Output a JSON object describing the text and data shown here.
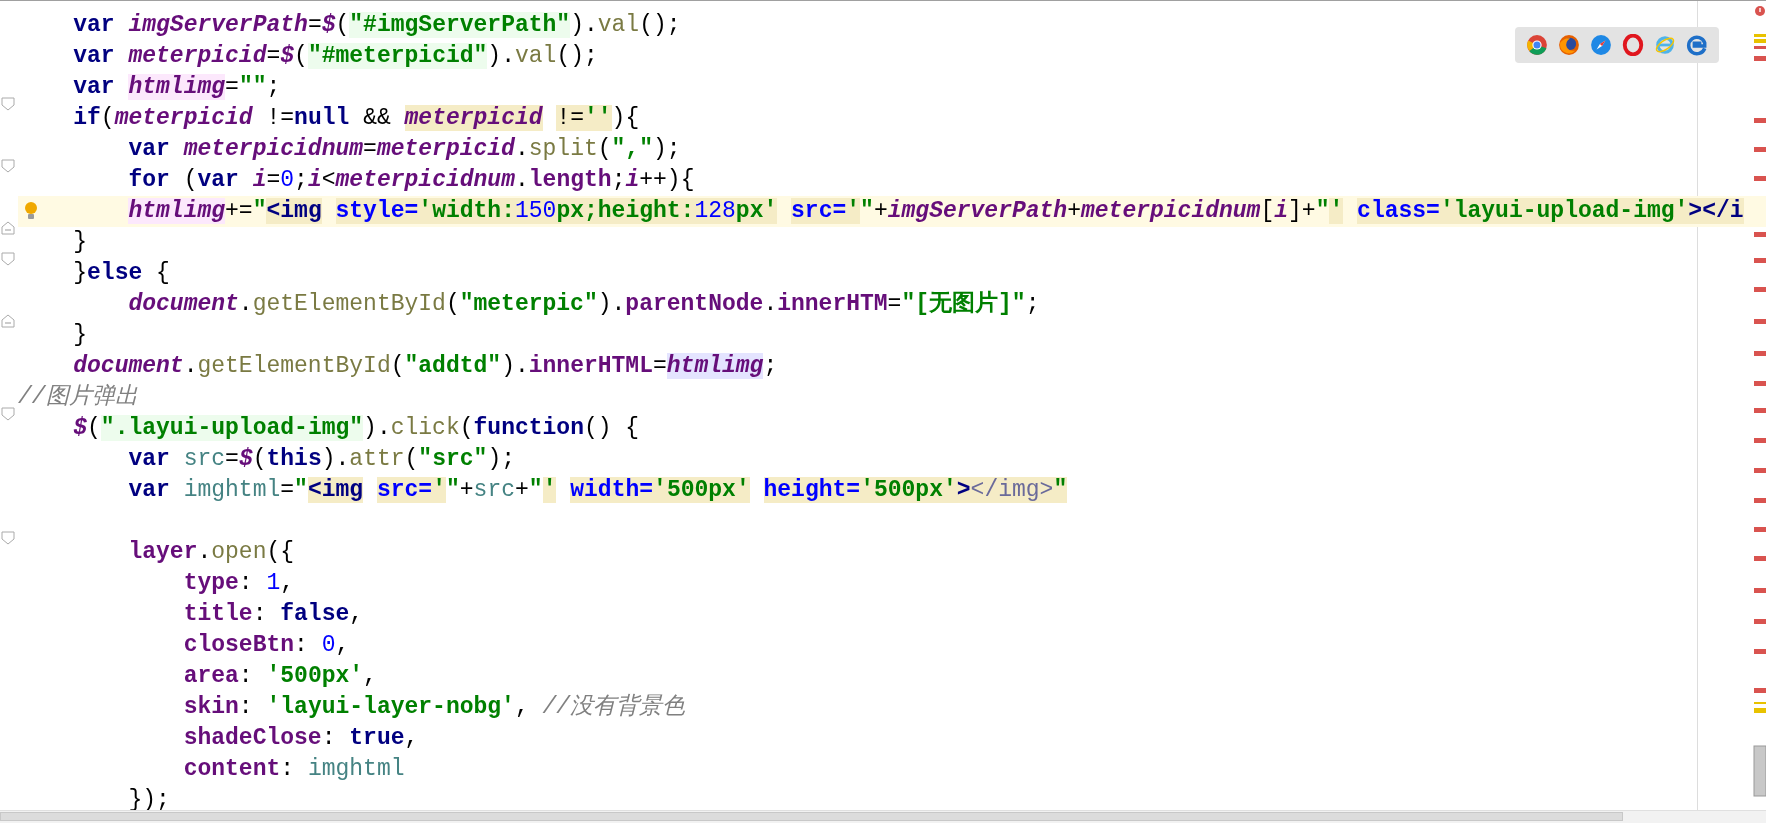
{
  "lines": [
    {
      "kind": "code",
      "current": false,
      "tokens": [
        {
          "text": "    var ",
          "kind": "kw"
        },
        {
          "text": "imgServerPath",
          "kind": "var"
        },
        {
          "text": "=",
          "kind": "plain"
        },
        {
          "text": "$",
          "kind": "glob"
        },
        {
          "text": "(",
          "kind": "plain"
        },
        {
          "text": "\"#imgServerPath\"",
          "kind": "str",
          "ref": true
        },
        {
          "text": ").",
          "kind": "plain"
        },
        {
          "text": "val",
          "kind": "fn"
        },
        {
          "text": "();",
          "kind": "plain"
        }
      ]
    },
    {
      "kind": "code",
      "current": false,
      "tokens": [
        {
          "text": "    var ",
          "kind": "kw"
        },
        {
          "text": "meterpicid",
          "kind": "var"
        },
        {
          "text": "=",
          "kind": "plain"
        },
        {
          "text": "$",
          "kind": "glob"
        },
        {
          "text": "(",
          "kind": "plain"
        },
        {
          "text": "\"#meterpicid\"",
          "kind": "str",
          "ref": true
        },
        {
          "text": ").",
          "kind": "plain"
        },
        {
          "text": "val",
          "kind": "fn"
        },
        {
          "text": "();",
          "kind": "plain"
        }
      ]
    },
    {
      "kind": "code",
      "current": false,
      "tokens": [
        {
          "text": "    var ",
          "kind": "kw"
        },
        {
          "text": "htmlimg",
          "kind": "var",
          "write": true
        },
        {
          "text": "=",
          "kind": "plain"
        },
        {
          "text": "\"\"",
          "kind": "str"
        },
        {
          "text": ";",
          "kind": "plain"
        }
      ]
    },
    {
      "kind": "code",
      "current": false,
      "fold_start": true,
      "tokens": [
        {
          "text": "    if",
          "kind": "kw"
        },
        {
          "text": "(",
          "kind": "plain"
        },
        {
          "text": "meterpicid",
          "kind": "var"
        },
        {
          "text": " !=",
          "kind": "plain"
        },
        {
          "text": "null",
          "kind": "kw"
        },
        {
          "text": " && ",
          "kind": "plain"
        },
        {
          "text": "meterpicid",
          "kind": "var",
          "injected": true
        },
        {
          "text": " !=",
          "kind": "plain",
          "injected": true
        },
        {
          "text": "''",
          "kind": "str",
          "injected": true
        },
        {
          "text": "){",
          "kind": "plain"
        }
      ]
    },
    {
      "kind": "code",
      "current": false,
      "tokens": [
        {
          "text": "        var ",
          "kind": "kw"
        },
        {
          "text": "meterpicidnum",
          "kind": "var"
        },
        {
          "text": "=",
          "kind": "plain"
        },
        {
          "text": "meterpicid",
          "kind": "var"
        },
        {
          "text": ".",
          "kind": "plain"
        },
        {
          "text": "split",
          "kind": "fn"
        },
        {
          "text": "(",
          "kind": "plain"
        },
        {
          "text": "\",\"",
          "kind": "str"
        },
        {
          "text": ");",
          "kind": "plain"
        }
      ]
    },
    {
      "kind": "code",
      "current": false,
      "fold_start": true,
      "tokens": [
        {
          "text": "        for ",
          "kind": "kw"
        },
        {
          "text": "(",
          "kind": "plain"
        },
        {
          "text": "var ",
          "kind": "kw"
        },
        {
          "text": "i",
          "kind": "var"
        },
        {
          "text": "=",
          "kind": "plain"
        },
        {
          "text": "0",
          "kind": "num"
        },
        {
          "text": ";",
          "kind": "plain"
        },
        {
          "text": "i",
          "kind": "var"
        },
        {
          "text": "<",
          "kind": "plain"
        },
        {
          "text": "meterpicidnum",
          "kind": "var"
        },
        {
          "text": ".",
          "kind": "plain"
        },
        {
          "text": "length",
          "kind": "prop"
        },
        {
          "text": ";",
          "kind": "plain"
        },
        {
          "text": "i",
          "kind": "var"
        },
        {
          "text": "++){",
          "kind": "plain"
        }
      ]
    },
    {
      "kind": "code",
      "current": true,
      "bulb": true,
      "tokens": [
        {
          "text": "        htmlimg",
          "kind": "var",
          "write": true
        },
        {
          "text": "+=",
          "kind": "plain"
        },
        {
          "text": "\"",
          "kind": "str"
        },
        {
          "text": "<img",
          "kind": "tag",
          "injected": true
        },
        {
          "text": " style=",
          "kind": "attr",
          "injected": true
        },
        {
          "text": "'width:",
          "kind": "attrval",
          "injected": true
        },
        {
          "text": "150",
          "kind": "num",
          "injected": true
        },
        {
          "text": "px;height:",
          "kind": "attrval",
          "injected": true
        },
        {
          "text": "128",
          "kind": "num",
          "injected": true
        },
        {
          "text": "px'",
          "kind": "attrval",
          "injected": true
        },
        {
          "text": " src=",
          "kind": "attr",
          "injected": true
        },
        {
          "text": "'",
          "kind": "attrval",
          "injected": true
        },
        {
          "text": "\"",
          "kind": "str"
        },
        {
          "text": "+",
          "kind": "plain"
        },
        {
          "text": "imgServerPath",
          "kind": "var"
        },
        {
          "text": "+",
          "kind": "plain"
        },
        {
          "text": "meterpicidnum",
          "kind": "var"
        },
        {
          "text": "[",
          "kind": "plain"
        },
        {
          "text": "i",
          "kind": "var"
        },
        {
          "text": "]+",
          "kind": "plain"
        },
        {
          "text": "\"",
          "kind": "str"
        },
        {
          "text": "'",
          "kind": "attrval",
          "injected": true
        },
        {
          "text": " class=",
          "kind": "attr",
          "injected": true
        },
        {
          "text": "'layui-upload-img'",
          "kind": "attrval",
          "injected": true
        },
        {
          "text": "></i",
          "kind": "tag",
          "injected": true
        }
      ]
    },
    {
      "kind": "code",
      "current": false,
      "fold_end": true,
      "tokens": [
        {
          "text": "    }",
          "kind": "plain"
        }
      ]
    },
    {
      "kind": "code",
      "current": false,
      "fold_start": true,
      "tokens": [
        {
          "text": "    }",
          "kind": "plain"
        },
        {
          "text": "else",
          "kind": "kw"
        },
        {
          "text": " {",
          "kind": "plain"
        }
      ]
    },
    {
      "kind": "code",
      "current": false,
      "tokens": [
        {
          "text": "        document",
          "kind": "glob"
        },
        {
          "text": ".",
          "kind": "plain"
        },
        {
          "text": "getElementById",
          "kind": "fn"
        },
        {
          "text": "(",
          "kind": "plain"
        },
        {
          "text": "\"meterpic\"",
          "kind": "str"
        },
        {
          "text": ").",
          "kind": "plain"
        },
        {
          "text": "parentNode",
          "kind": "prop"
        },
        {
          "text": ".",
          "kind": "plain"
        },
        {
          "text": "innerHTM",
          "kind": "prop"
        },
        {
          "text": "=",
          "kind": "plain"
        },
        {
          "text": "\"[无图片]\"",
          "kind": "str"
        },
        {
          "text": ";",
          "kind": "plain"
        }
      ]
    },
    {
      "kind": "code",
      "current": false,
      "fold_end": true,
      "tokens": [
        {
          "text": "    }",
          "kind": "plain"
        }
      ]
    },
    {
      "kind": "code",
      "current": false,
      "tokens": [
        {
          "text": "    document",
          "kind": "glob"
        },
        {
          "text": ".",
          "kind": "plain"
        },
        {
          "text": "getElementById",
          "kind": "fn"
        },
        {
          "text": "(",
          "kind": "plain"
        },
        {
          "text": "\"addtd\"",
          "kind": "str"
        },
        {
          "text": ").",
          "kind": "plain"
        },
        {
          "text": "innerHTML",
          "kind": "prop"
        },
        {
          "text": "=",
          "kind": "plain"
        },
        {
          "text": "htmlimg",
          "kind": "var",
          "read": true
        },
        {
          "text": ";",
          "kind": "plain"
        }
      ]
    },
    {
      "kind": "code",
      "current": false,
      "tokens": [
        {
          "text": "//图片弹出",
          "kind": "cmt"
        }
      ]
    },
    {
      "kind": "code",
      "current": false,
      "fold_start": true,
      "tokens": [
        {
          "text": "    $",
          "kind": "glob"
        },
        {
          "text": "(",
          "kind": "plain"
        },
        {
          "text": "\".layui-upload-img\"",
          "kind": "str",
          "ref": true
        },
        {
          "text": ").",
          "kind": "plain"
        },
        {
          "text": "click",
          "kind": "fn"
        },
        {
          "text": "(",
          "kind": "plain"
        },
        {
          "text": "function",
          "kind": "kw"
        },
        {
          "text": "() {",
          "kind": "plain"
        }
      ]
    },
    {
      "kind": "code",
      "current": false,
      "tokens": [
        {
          "text": "        var ",
          "kind": "kw"
        },
        {
          "text": "src",
          "kind": "param"
        },
        {
          "text": "=",
          "kind": "plain"
        },
        {
          "text": "$",
          "kind": "glob"
        },
        {
          "text": "(",
          "kind": "plain"
        },
        {
          "text": "this",
          "kind": "kw"
        },
        {
          "text": ").",
          "kind": "plain"
        },
        {
          "text": "attr",
          "kind": "fn"
        },
        {
          "text": "(",
          "kind": "plain"
        },
        {
          "text": "\"src\"",
          "kind": "str"
        },
        {
          "text": ");",
          "kind": "plain"
        }
      ]
    },
    {
      "kind": "code",
      "current": false,
      "tokens": [
        {
          "text": "        var ",
          "kind": "kw"
        },
        {
          "text": "imghtml",
          "kind": "param"
        },
        {
          "text": "=",
          "kind": "plain"
        },
        {
          "text": "\"",
          "kind": "str"
        },
        {
          "text": "<img",
          "kind": "tag",
          "injected": true
        },
        {
          "text": " src=",
          "kind": "attr",
          "injected": true
        },
        {
          "text": "'",
          "kind": "attrval",
          "injected": true
        },
        {
          "text": "\"",
          "kind": "str"
        },
        {
          "text": "+",
          "kind": "plain"
        },
        {
          "text": "src",
          "kind": "param"
        },
        {
          "text": "+",
          "kind": "plain"
        },
        {
          "text": "\"",
          "kind": "str"
        },
        {
          "text": "'",
          "kind": "attrval",
          "injected": true
        },
        {
          "text": " width=",
          "kind": "attr",
          "injected": true
        },
        {
          "text": "'500px'",
          "kind": "attrval",
          "injected": true
        },
        {
          "text": " height=",
          "kind": "attr",
          "injected": true
        },
        {
          "text": "'500px'",
          "kind": "attrval",
          "injected": true
        },
        {
          "text": ">",
          "kind": "tag",
          "injected": true
        },
        {
          "text": "</img>",
          "kind": "endtag",
          "injected": true
        },
        {
          "text": "\"",
          "kind": "str",
          "injected": true
        }
      ]
    },
    {
      "kind": "blank",
      "current": false
    },
    {
      "kind": "code",
      "current": false,
      "fold_start": true,
      "tokens": [
        {
          "text": "        layer",
          "kind": "prop"
        },
        {
          "text": ".",
          "kind": "plain"
        },
        {
          "text": "open",
          "kind": "fn"
        },
        {
          "text": "({",
          "kind": "plain"
        }
      ]
    },
    {
      "kind": "code",
      "current": false,
      "tokens": [
        {
          "text": "            type",
          "kind": "prop"
        },
        {
          "text": ": ",
          "kind": "plain"
        },
        {
          "text": "1",
          "kind": "num"
        },
        {
          "text": ",",
          "kind": "plain"
        }
      ]
    },
    {
      "kind": "code",
      "current": false,
      "tokens": [
        {
          "text": "            title",
          "kind": "prop"
        },
        {
          "text": ": ",
          "kind": "plain"
        },
        {
          "text": "false",
          "kind": "kw"
        },
        {
          "text": ",",
          "kind": "plain"
        }
      ]
    },
    {
      "kind": "code",
      "current": false,
      "tokens": [
        {
          "text": "            closeBtn",
          "kind": "prop"
        },
        {
          "text": ": ",
          "kind": "plain"
        },
        {
          "text": "0",
          "kind": "num"
        },
        {
          "text": ",",
          "kind": "plain"
        }
      ]
    },
    {
      "kind": "code",
      "current": false,
      "tokens": [
        {
          "text": "            area",
          "kind": "prop"
        },
        {
          "text": ": ",
          "kind": "plain"
        },
        {
          "text": "'500px'",
          "kind": "str"
        },
        {
          "text": ",",
          "kind": "plain"
        }
      ]
    },
    {
      "kind": "code",
      "current": false,
      "tokens": [
        {
          "text": "            skin",
          "kind": "prop"
        },
        {
          "text": ": ",
          "kind": "plain"
        },
        {
          "text": "'layui-layer-nobg'",
          "kind": "str"
        },
        {
          "text": ", ",
          "kind": "plain"
        },
        {
          "text": "//没有背景色",
          "kind": "cmt"
        }
      ]
    },
    {
      "kind": "code",
      "current": false,
      "tokens": [
        {
          "text": "            shadeClose",
          "kind": "prop"
        },
        {
          "text": ": ",
          "kind": "plain"
        },
        {
          "text": "true",
          "kind": "kw"
        },
        {
          "text": ",",
          "kind": "plain"
        }
      ]
    },
    {
      "kind": "code",
      "current": false,
      "tokens": [
        {
          "text": "            content",
          "kind": "prop"
        },
        {
          "text": ": ",
          "kind": "plain"
        },
        {
          "text": "imghtml",
          "kind": "param"
        }
      ]
    },
    {
      "kind": "code",
      "current": false,
      "tokens": [
        {
          "text": "        });",
          "kind": "plain"
        }
      ]
    }
  ]
}
